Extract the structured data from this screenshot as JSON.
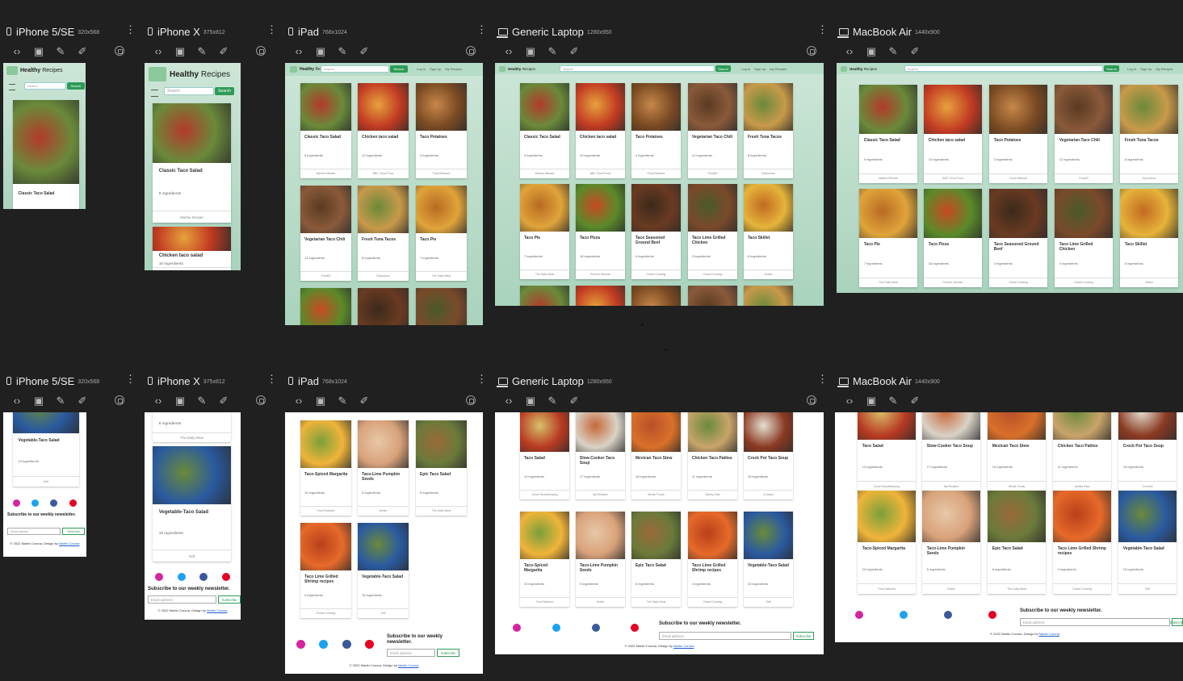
{
  "colors": {
    "bg": "#202020",
    "accent": "#2d9b57",
    "header_green": "#b5dcc7",
    "insta": "#d6249f",
    "twitter": "#1da1f2",
    "facebook": "#3b5998",
    "pinterest": "#e60023"
  },
  "devices": [
    {
      "name": "iPhone 5/SE",
      "dim": "320x568"
    },
    {
      "name": "iPhone X",
      "dim": "375x812"
    },
    {
      "name": "iPad",
      "dim": "768x1024"
    },
    {
      "name": "Generic Laptop",
      "dim": "1280x950"
    },
    {
      "name": "MacBook Air",
      "dim": "1440x900"
    }
  ],
  "tool_icons": [
    "code-icon",
    "screenshot-icon",
    "paint-icon",
    "edit-icon"
  ],
  "site": {
    "title_bold": "Healthy",
    "title_rest": " Recipes",
    "search_placeholder": "Search",
    "search_button": "Search",
    "nav": [
      "Log In",
      "Sign Up",
      "My Recipes"
    ],
    "newsletter": "Subscribe to our weekly newsletter.",
    "email_placeholder": "Email address",
    "subscribe_button": "Subscribe",
    "copyright": "© 2022 Martin Corona. Design by ",
    "copyright_link": "Martin Corona"
  },
  "recipes_top": [
    {
      "title": "Classic Taco Salad",
      "ing": "9 ingredients",
      "src": "Martha Stewart",
      "c1": "#6a8a3a",
      "c2": "#b23a2a"
    },
    {
      "title": "Chicken taco salad",
      "ing": "10 ingredients",
      "src": "BBC Good Food",
      "c1": "#c23b22",
      "c2": "#e6a23c"
    },
    {
      "title": "Taco Potatoes",
      "ing": "3 ingredients",
      "src": "Food Network",
      "c1": "#7a4a22",
      "c2": "#c7874a"
    },
    {
      "title": "Vegetarian Taco Chili",
      "ing": "12 ingredients",
      "src": "Food52",
      "c1": "#8a5a3a",
      "c2": "#5a3a22"
    },
    {
      "title": "Fresh Tuna Tacos",
      "ing": "8 ingredients",
      "src": "Epicurious",
      "c1": "#c89a4a",
      "c2": "#6a8a3a"
    },
    {
      "title": "Taco Pie",
      "ing": "7 ingredients",
      "src": "The Daily Meal",
      "c1": "#e0a43a",
      "c2": "#b86a22"
    },
    {
      "title": "Taco Pizza",
      "ing": "16 ingredients",
      "src": "Pioneer Woman",
      "c1": "#5a8a2a",
      "c2": "#c84a22"
    },
    {
      "title": "Taco Seasoned Ground Beef",
      "ing": "4 ingredients",
      "src": "Closet Cooking",
      "c1": "#6a3a22",
      "c2": "#3a2a1a"
    },
    {
      "title": "Taco Lime Grilled Chicken",
      "ing": "3 ingredients",
      "src": "Closet Cooking",
      "c1": "#7a4a2a",
      "c2": "#4a5a2a"
    },
    {
      "title": "Taco Skillet",
      "ing": "8 ingredients",
      "src": "Delish",
      "c1": "#e6b43a",
      "c2": "#c26a22"
    }
  ],
  "recipes_bottom": [
    {
      "title": "Taco Salad",
      "ing": "10 ingredients",
      "src": "Good Housekeeping",
      "c1": "#b83a22",
      "c2": "#d8c06a"
    },
    {
      "title": "Slow-Cooker Taco Soup",
      "ing": "17 ingredients",
      "src": "My Recipes",
      "c1": "#d9d2c6",
      "c2": "#c8683a"
    },
    {
      "title": "Mexican Taco Stew",
      "ing": "16 ingredients",
      "src": "Whole Foods",
      "c1": "#d9702a",
      "c2": "#b8502a"
    },
    {
      "title": "Chicken Taco Patties",
      "ing": "11 ingredients",
      "src": "Ashley Eats",
      "c1": "#c8a46a",
      "c2": "#6a8a3a"
    },
    {
      "title": "Crock Pot Taco Soup",
      "ing": "15 ingredients",
      "src": "Crockful",
      "c1": "#8a3a22",
      "c2": "#e6e0d2"
    },
    {
      "title": "Taco-Spiced Margarita",
      "ing": "10 ingredients",
      "src": "Food Network",
      "c1": "#f0b43a",
      "c2": "#7aa03a"
    },
    {
      "title": "Taco-Lime Pumpkin Seeds",
      "ing": "5 ingredients",
      "src": "Delish",
      "c1": "#d8a27a",
      "c2": "#e8c8a8"
    },
    {
      "title": "Epic Taco Salad",
      "ing": "8 ingredients",
      "src": "The Daily Meal",
      "c1": "#6a7a3a",
      "c2": "#9a6a3a"
    },
    {
      "title": "Taco Lime Grilled Shrimp recipes",
      "ing": "4 ingredients",
      "src": "Closet Cooking",
      "c1": "#e66a2a",
      "c2": "#b8401a"
    },
    {
      "title": "Vegetable-Taco Salad",
      "ing": "15 ingredients",
      "src": "Self",
      "c1": "#2a5aa0",
      "c2": "#6a8a3a"
    }
  ]
}
